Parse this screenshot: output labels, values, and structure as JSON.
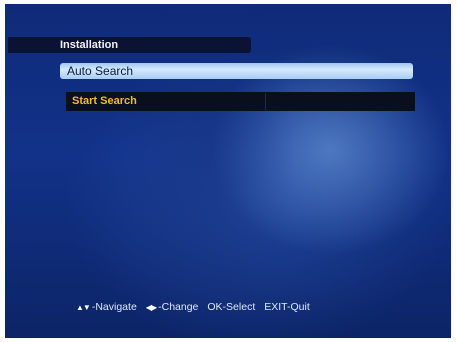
{
  "header": {
    "title": "Installation"
  },
  "menu": {
    "selected_item": "Auto Search"
  },
  "options": [
    {
      "label": "Start Search",
      "value": ""
    }
  ],
  "footer": {
    "hints": [
      {
        "icon": "up-down-arrows-icon",
        "glyph": "▲▼",
        "text": "-Navigate"
      },
      {
        "icon": "left-right-arrows-icon",
        "glyph": "◀▶",
        "text": "-Change"
      },
      {
        "icon": "",
        "glyph": "",
        "text": "OK-Select"
      },
      {
        "icon": "",
        "glyph": "",
        "text": "EXIT-Quit"
      }
    ]
  },
  "colors": {
    "background": "#123289",
    "highlight": "#d6e9fb",
    "option_text": "#f4b838",
    "title_bar": "#0b1233"
  }
}
